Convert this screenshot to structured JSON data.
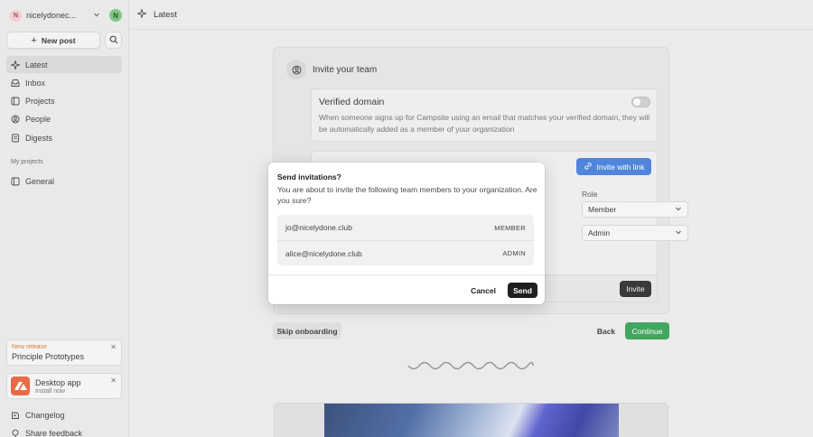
{
  "sidebar": {
    "org_initial": "N",
    "org_name": "nicelydonec...",
    "user_initial": "N",
    "new_post_label": "New post",
    "nav": [
      {
        "label": "Latest",
        "icon": "sparkle-icon",
        "active": true
      },
      {
        "label": "Inbox",
        "icon": "inbox-icon"
      },
      {
        "label": "Projects",
        "icon": "projects-icon"
      },
      {
        "label": "People",
        "icon": "people-icon"
      },
      {
        "label": "Digests",
        "icon": "digests-icon"
      }
    ],
    "projects_label": "My projects",
    "projects": [
      {
        "label": "General",
        "icon": "project-icon"
      }
    ],
    "release_card": {
      "tag": "New release",
      "title": "Principle Prototypes"
    },
    "desktop_card": {
      "title": "Desktop app",
      "subtitle": "Install now"
    },
    "bottom": [
      {
        "label": "Changelog",
        "icon": "changelog-icon"
      },
      {
        "label": "Share feedback",
        "icon": "feedback-icon"
      }
    ]
  },
  "topbar": {
    "title": "Latest"
  },
  "invite_panel": {
    "title": "Invite your team",
    "verified_title": "Verified domain",
    "verified_desc": "When someone signs up for Campsite using an email that matches your verified domain, they will be automatically added as a member of your organization",
    "invite_link_label": "Invite with link",
    "role_label": "Role",
    "roles": [
      "Member",
      "Admin"
    ],
    "invite_button": "Invite"
  },
  "footer": {
    "skip": "Skip onboarding",
    "back": "Back",
    "continue": "Continue"
  },
  "modal": {
    "title": "Send invitations?",
    "description": "You are about to invite the following team members to your organization. Are you sure?",
    "invites": [
      {
        "email": "jo@nicelydone.club",
        "role": "MEMBER"
      },
      {
        "email": "alice@nicelydone.club",
        "role": "ADMIN"
      }
    ],
    "cancel": "Cancel",
    "send": "Send"
  },
  "colors": {
    "accent_blue": "#3a75d8",
    "continue_green": "#2a9a4a",
    "release_orange": "#d16b19",
    "app_icon": "#e8552e"
  }
}
